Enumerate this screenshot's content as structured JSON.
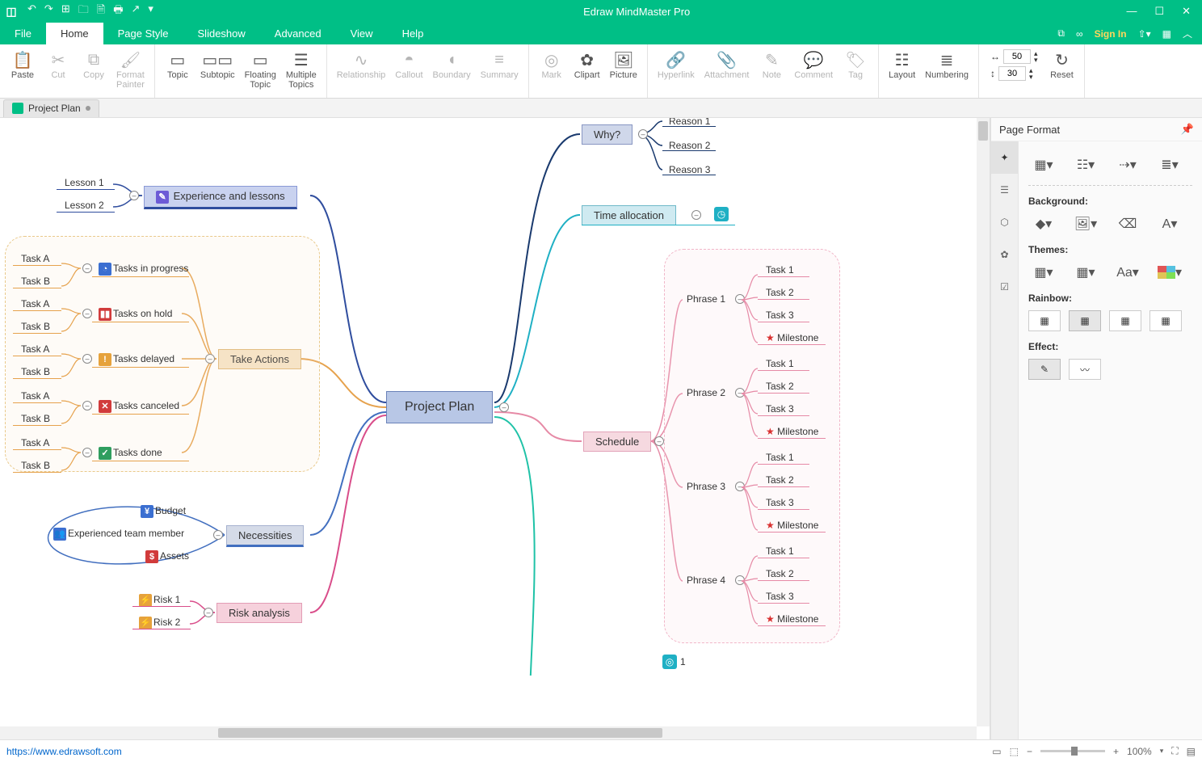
{
  "app": {
    "title": "Edraw MindMaster Pro"
  },
  "qat": [
    "↶",
    "↷",
    "⊞",
    "🗀",
    "🗎",
    "🖶",
    "↗",
    "▾"
  ],
  "wincontrols": {
    "min": "—",
    "max": "☐",
    "close": "✕"
  },
  "menu": {
    "items": [
      "File",
      "Home",
      "Page Style",
      "Slideshow",
      "Advanced",
      "View",
      "Help"
    ],
    "active": 1,
    "signin": "Sign In"
  },
  "ribbon": {
    "clip": {
      "paste": "Paste",
      "cut": "Cut",
      "copy": "Copy",
      "fmt": "Format\nPainter"
    },
    "topics": {
      "topic": "Topic",
      "subtopic": "Subtopic",
      "floating": "Floating\nTopic",
      "multiple": "Multiple\nTopics"
    },
    "relate": {
      "rel": "Relationship",
      "callout": "Callout",
      "boundary": "Boundary",
      "summary": "Summary"
    },
    "insert": {
      "mark": "Mark",
      "clipart": "Clipart",
      "picture": "Picture"
    },
    "attach": {
      "hyperlink": "Hyperlink",
      "attachment": "Attachment",
      "note": "Note",
      "comment": "Comment",
      "tag": "Tag"
    },
    "layout": {
      "layout": "Layout",
      "numbering": "Numbering"
    },
    "spacing": {
      "h": "50",
      "v": "30"
    },
    "reset": "Reset"
  },
  "doc": {
    "name": "Project Plan"
  },
  "map": {
    "central": "Project Plan",
    "why": {
      "label": "Why?",
      "reasons": [
        "Reason 1",
        "Reason 2",
        "Reason 3"
      ]
    },
    "time": {
      "label": "Time allocation"
    },
    "schedule": {
      "label": "Schedule",
      "phrases": [
        {
          "label": "Phrase 1",
          "tasks": [
            "Task 1",
            "Task 2",
            "Task 3"
          ],
          "milestone": "Milestone"
        },
        {
          "label": "Phrase 2",
          "tasks": [
            "Task 1",
            "Task 2",
            "Task 3"
          ],
          "milestone": "Milestone"
        },
        {
          "label": "Phrase 3",
          "tasks": [
            "Task 1",
            "Task 2",
            "Task 3"
          ],
          "milestone": "Milestone"
        },
        {
          "label": "Phrase 4",
          "tasks": [
            "Task 1",
            "Task 2",
            "Task 3"
          ],
          "milestone": "Milestone"
        }
      ]
    },
    "experience": {
      "label": "Experience and lessons",
      "lessons": [
        "Lesson 1",
        "Lesson 2"
      ]
    },
    "actions": {
      "label": "Take Actions",
      "groups": [
        {
          "label": "Tasks in progress",
          "tasks": [
            "Task A",
            "Task B"
          ]
        },
        {
          "label": "Tasks on hold",
          "tasks": [
            "Task A",
            "Task B"
          ]
        },
        {
          "label": "Tasks delayed",
          "tasks": [
            "Task A",
            "Task B"
          ]
        },
        {
          "label": "Tasks canceled",
          "tasks": [
            "Task A",
            "Task B"
          ]
        },
        {
          "label": "Tasks done",
          "tasks": [
            "Task A",
            "Task B"
          ]
        }
      ]
    },
    "necessities": {
      "label": "Necessities",
      "items": [
        "Budget",
        "Experienced team member",
        "Assets"
      ]
    },
    "risk": {
      "label": "Risk analysis",
      "items": [
        "Risk 1",
        "Risk 2"
      ]
    },
    "target_count": "1"
  },
  "side": {
    "title": "Page Format",
    "background": "Background:",
    "themes": "Themes:",
    "rainbow": "Rainbow:",
    "effect": "Effect:"
  },
  "status": {
    "url": "https://www.edrawsoft.com",
    "zoom": "100%"
  }
}
